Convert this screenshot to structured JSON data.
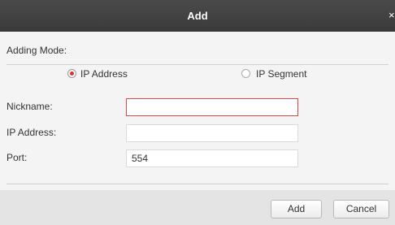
{
  "dialog": {
    "title": "Add",
    "close_glyph": "×"
  },
  "form": {
    "adding_mode_label": "Adding Mode:",
    "modes": [
      {
        "label": "IP Address",
        "selected": true
      },
      {
        "label": "IP Segment",
        "selected": false
      }
    ],
    "nickname": {
      "label": "Nickname:",
      "value": ""
    },
    "ip_address": {
      "label": "IP Address:",
      "value": ""
    },
    "port": {
      "label": "Port:",
      "value": "554"
    }
  },
  "buttons": {
    "add_label": "Add",
    "cancel_label": "Cancel"
  },
  "colors": {
    "titlebar": "#3f3f3f",
    "radio_selected": "#e13030",
    "focus_border": "#d74a4a"
  }
}
